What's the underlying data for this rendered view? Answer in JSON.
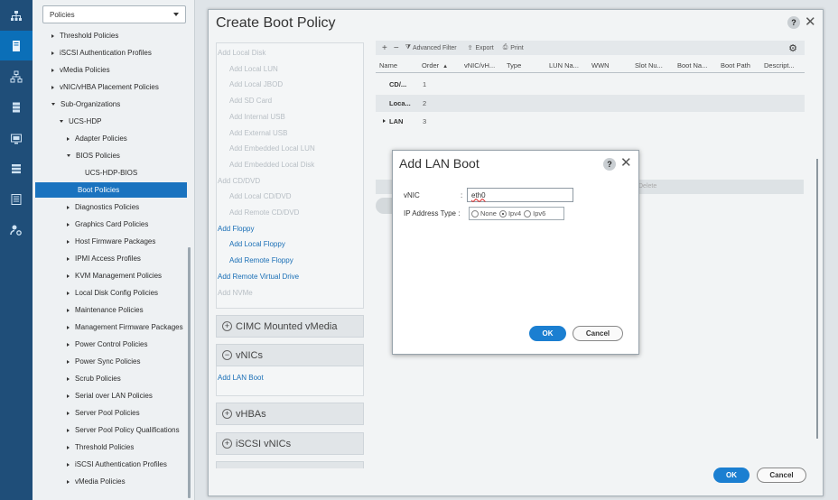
{
  "nav": {
    "policy_select": "Policies",
    "items": [
      {
        "label": "Threshold Policies",
        "indent": 1,
        "expander": "right",
        "selected": false
      },
      {
        "label": "iSCSI Authentication Profiles",
        "indent": 1,
        "expander": "right",
        "selected": false
      },
      {
        "label": "vMedia Policies",
        "indent": 1,
        "expander": "right",
        "selected": false
      },
      {
        "label": "vNIC/vHBA Placement Policies",
        "indent": 1,
        "expander": "right",
        "selected": false
      },
      {
        "label": "Sub-Organizations",
        "indent": 1,
        "expander": "down",
        "selected": false
      },
      {
        "label": "UCS-HDP",
        "indent": 2,
        "expander": "down",
        "selected": false
      },
      {
        "label": "Adapter Policies",
        "indent": 3,
        "expander": "right",
        "selected": false
      },
      {
        "label": "BIOS Policies",
        "indent": 3,
        "expander": "down",
        "selected": false
      },
      {
        "label": "UCS-HDP-BIOS",
        "indent": 4,
        "expander": "none",
        "selected": false
      },
      {
        "label": "Boot Policies",
        "indent": 3,
        "expander": "none",
        "selected": true
      },
      {
        "label": "Diagnostics Policies",
        "indent": 3,
        "expander": "right",
        "selected": false
      },
      {
        "label": "Graphics Card Policies",
        "indent": 3,
        "expander": "right",
        "selected": false
      },
      {
        "label": "Host Firmware Packages",
        "indent": 3,
        "expander": "right",
        "selected": false
      },
      {
        "label": "IPMI Access Profiles",
        "indent": 3,
        "expander": "right",
        "selected": false
      },
      {
        "label": "KVM Management Policies",
        "indent": 3,
        "expander": "right",
        "selected": false
      },
      {
        "label": "Local Disk Config Policies",
        "indent": 3,
        "expander": "right",
        "selected": false
      },
      {
        "label": "Maintenance Policies",
        "indent": 3,
        "expander": "right",
        "selected": false
      },
      {
        "label": "Management Firmware Packages",
        "indent": 3,
        "expander": "right",
        "selected": false
      },
      {
        "label": "Power Control Policies",
        "indent": 3,
        "expander": "right",
        "selected": false
      },
      {
        "label": "Power Sync Policies",
        "indent": 3,
        "expander": "right",
        "selected": false
      },
      {
        "label": "Scrub Policies",
        "indent": 3,
        "expander": "right",
        "selected": false
      },
      {
        "label": "Serial over LAN Policies",
        "indent": 3,
        "expander": "right",
        "selected": false
      },
      {
        "label": "Server Pool Policies",
        "indent": 3,
        "expander": "right",
        "selected": false
      },
      {
        "label": "Server Pool Policy Qualifications",
        "indent": 3,
        "expander": "right",
        "selected": false
      },
      {
        "label": "Threshold Policies",
        "indent": 3,
        "expander": "right",
        "selected": false
      },
      {
        "label": "iSCSI Authentication Profiles",
        "indent": 3,
        "expander": "right",
        "selected": false
      },
      {
        "label": "vMedia Policies",
        "indent": 3,
        "expander": "right",
        "selected": false
      }
    ]
  },
  "rail": {
    "icons": [
      "network-icon",
      "server-icon",
      "lan-icon",
      "storage-icon",
      "chassis-icon",
      "vm-icon",
      "admin-icon",
      "settings-user-icon"
    ],
    "active_index": 1
  },
  "dialog": {
    "title": "Create Boot Policy",
    "help": "?",
    "close": "✕",
    "options": [
      {
        "label": "Add Local Disk",
        "active": false,
        "indent": 0
      },
      {
        "label": "Add Local LUN",
        "active": false,
        "indent": 1
      },
      {
        "label": "Add Local JBOD",
        "active": false,
        "indent": 1
      },
      {
        "label": "Add SD Card",
        "active": false,
        "indent": 1
      },
      {
        "label": "Add Internal USB",
        "active": false,
        "indent": 1
      },
      {
        "label": "Add External USB",
        "active": false,
        "indent": 1
      },
      {
        "label": "Add Embedded Local LUN",
        "active": false,
        "indent": 1
      },
      {
        "label": "Add Embedded Local Disk",
        "active": false,
        "indent": 1
      },
      {
        "label": "Add CD/DVD",
        "active": false,
        "indent": 0
      },
      {
        "label": "Add Local CD/DVD",
        "active": false,
        "indent": 1
      },
      {
        "label": "Add Remote CD/DVD",
        "active": false,
        "indent": 1
      },
      {
        "label": "Add Floppy",
        "active": true,
        "indent": 0
      },
      {
        "label": "Add Local Floppy",
        "active": true,
        "indent": 1
      },
      {
        "label": "Add Remote Floppy",
        "active": true,
        "indent": 1
      },
      {
        "label": "Add Remote Virtual Drive",
        "active": true,
        "indent": 0
      },
      {
        "label": "Add NVMe",
        "active": false,
        "indent": 0
      }
    ],
    "sections": {
      "cimc": "CIMC Mounted vMedia",
      "vnics": "vNICs",
      "add_lan_boot": "Add LAN Boot",
      "vhbas": "vHBAs",
      "iscsi": "iSCSI vNICs"
    },
    "toolbar": {
      "add": "+",
      "remove": "−",
      "advanced_filter": "Advanced Filter",
      "export": "Export",
      "print": "Print"
    },
    "table": {
      "headers": [
        "Name",
        "Order",
        "vNIC/vH...",
        "Type",
        "LUN Na...",
        "WWN",
        "Slot Nu...",
        "Boot Na...",
        "Boot Path",
        "Descript..."
      ],
      "sort_indicator": "▲",
      "rows": [
        {
          "name": "CD/...",
          "order": "1",
          "expander": false
        },
        {
          "name": "Loca...",
          "order": "2",
          "expander": false
        },
        {
          "name": "LAN",
          "order": "3",
          "expander": true
        }
      ],
      "ghost_text": "Delete"
    },
    "ok": "OK",
    "cancel": "Cancel"
  },
  "modal": {
    "title": "Add LAN Boot",
    "help": "?",
    "close": "✕",
    "vnic_label": "vNIC",
    "colon": ":",
    "vnic_value": "eth0",
    "ip_label": "IP Address Type :",
    "ip_options": [
      {
        "label": "None",
        "selected": false
      },
      {
        "label": "Ipv4",
        "selected": true
      },
      {
        "label": "Ipv6",
        "selected": false
      }
    ],
    "ok": "OK",
    "cancel": "Cancel"
  }
}
